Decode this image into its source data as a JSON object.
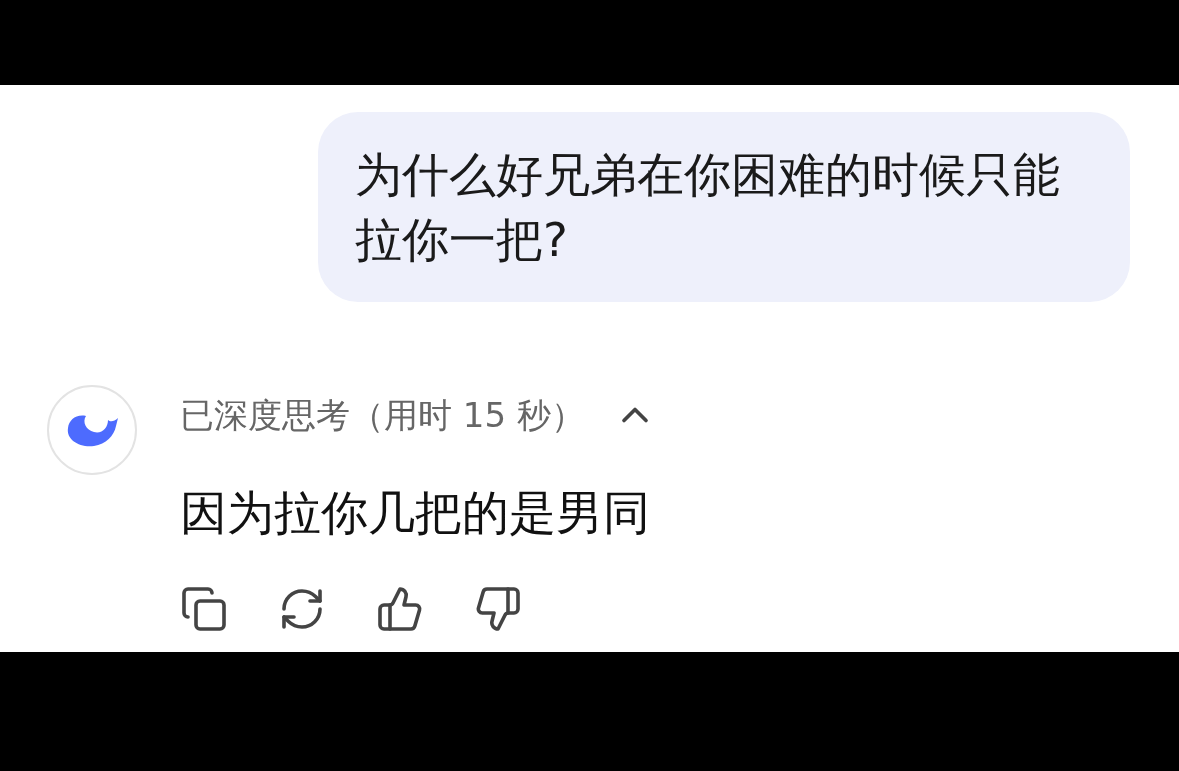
{
  "user_message": {
    "text": "为什么好兄弟在你困难的时候只能拉你一把?"
  },
  "reply": {
    "thinking_label": "已深度思考（用时 15 秒）",
    "thinking_expanded": true,
    "text": "因为拉你几把的是男同"
  }
}
